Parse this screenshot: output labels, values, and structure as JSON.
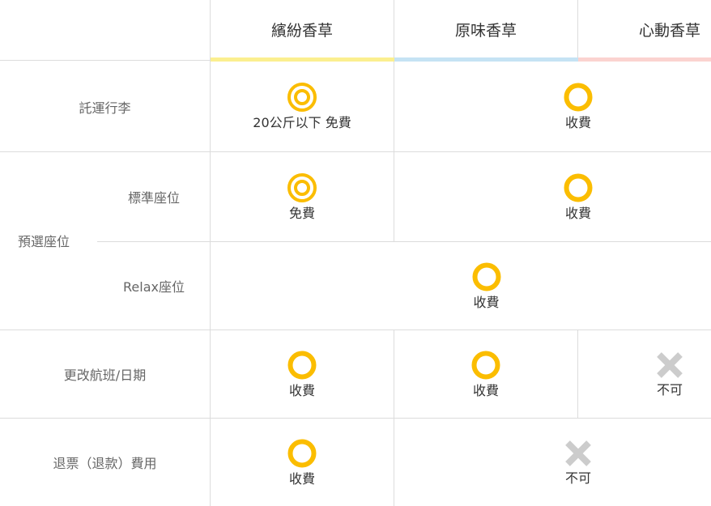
{
  "header": {
    "plans": [
      {
        "name": "繽紛香草",
        "color": "#fbef8f"
      },
      {
        "name": "原味香草",
        "color": "#c5e3f4"
      },
      {
        "name": "心動香草",
        "color": "#fbd3d0"
      }
    ]
  },
  "rows": {
    "baggage": {
      "label": "託運行李",
      "plan1": "20公斤以下 免費",
      "plan2_3": "收費"
    },
    "seat_group": {
      "label": "預選座位"
    },
    "standard_seat": {
      "label": "標準座位",
      "plan1": "免費",
      "plan2_3": "收費"
    },
    "relax_seat": {
      "label": "Relax座位",
      "all": "收費"
    },
    "change": {
      "label": "更改航班/日期",
      "plan1": "收費",
      "plan2": "收費",
      "plan3": "不可"
    },
    "refund": {
      "label": "退票（退款）費用",
      "plan1": "收費",
      "plan2_3": "不可"
    }
  },
  "icons": {
    "double_circle": "double-circle-icon",
    "circle": "circle-icon",
    "cross": "cross-icon"
  },
  "colors": {
    "icon_yellow": "#fbbd00",
    "icon_gray": "#cccccc",
    "line": "#dcdcdc"
  }
}
